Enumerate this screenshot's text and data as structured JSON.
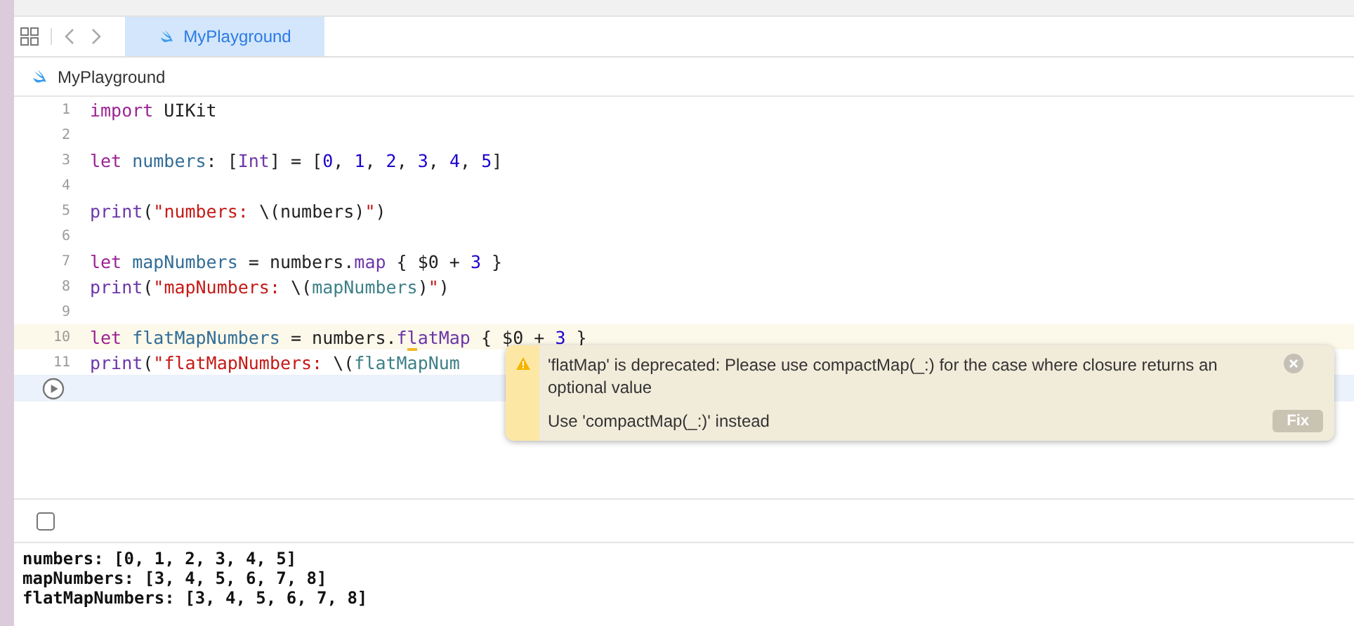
{
  "tabs": [
    {
      "label": "MyPlayground",
      "selected": true
    }
  ],
  "breadcrumb": "MyPlayground",
  "lines": [
    {
      "number": "1",
      "current": false,
      "tokens": [
        {
          "kind": "keyword",
          "text": "import"
        },
        {
          "kind": "plain",
          "text": " UIKit"
        }
      ]
    },
    {
      "number": "2",
      "current": false
    },
    {
      "number": "3",
      "current": false,
      "tokens": [
        {
          "kind": "keyword",
          "text": "let"
        },
        {
          "kind": "decl",
          "text": " numbers"
        },
        {
          "kind": "plain",
          "text": ": ["
        },
        {
          "kind": "type",
          "text": "Int"
        },
        {
          "kind": "plain",
          "text": "] = ["
        },
        {
          "kind": "number",
          "text": "0"
        },
        {
          "kind": "plain",
          "text": ", "
        },
        {
          "kind": "number",
          "text": "1"
        },
        {
          "kind": "plain",
          "text": ", "
        },
        {
          "kind": "number",
          "text": "2"
        },
        {
          "kind": "plain",
          "text": ", "
        },
        {
          "kind": "number",
          "text": "3"
        },
        {
          "kind": "plain",
          "text": ", "
        },
        {
          "kind": "number",
          "text": "4"
        },
        {
          "kind": "plain",
          "text": ", "
        },
        {
          "kind": "number",
          "text": "5"
        },
        {
          "kind": "plain",
          "text": "]"
        }
      ]
    },
    {
      "number": "4",
      "current": false
    },
    {
      "number": "5",
      "current": false,
      "tokens": [
        {
          "kind": "func",
          "text": "print"
        },
        {
          "kind": "plain",
          "text": "("
        },
        {
          "kind": "string",
          "text": "\"numbers: "
        },
        {
          "kind": "plain",
          "text": "\\(numbers)"
        },
        {
          "kind": "string",
          "text": "\""
        },
        {
          "kind": "plain",
          "text": ")"
        }
      ]
    },
    {
      "number": "6",
      "current": false
    },
    {
      "number": "7",
      "current": false,
      "tokens": [
        {
          "kind": "keyword",
          "text": "let"
        },
        {
          "kind": "decl",
          "text": " mapNumbers"
        },
        {
          "kind": "plain",
          "text": " = numbers."
        },
        {
          "kind": "func",
          "text": "map"
        },
        {
          "kind": "plain",
          "text": " { $0 + "
        },
        {
          "kind": "number",
          "text": "3"
        },
        {
          "kind": "plain",
          "text": " }"
        }
      ]
    },
    {
      "number": "8",
      "current": false,
      "tokens": [
        {
          "kind": "func",
          "text": "print"
        },
        {
          "kind": "plain",
          "text": "("
        },
        {
          "kind": "string",
          "text": "\"mapNumbers: "
        },
        {
          "kind": "plain",
          "text": "\\("
        },
        {
          "kind": "ident",
          "text": "mapNumbers"
        },
        {
          "kind": "plain",
          "text": ")"
        },
        {
          "kind": "string",
          "text": "\""
        },
        {
          "kind": "plain",
          "text": ")"
        }
      ]
    },
    {
      "number": "9",
      "current": false
    },
    {
      "number": "10",
      "current": true,
      "tokens": [
        {
          "kind": "keyword",
          "text": "let"
        },
        {
          "kind": "decl",
          "text": " flatMapNumbers"
        },
        {
          "kind": "plain",
          "text": " = numbers."
        },
        {
          "kind": "func",
          "text": "f"
        },
        {
          "kind": "warn",
          "text": "l"
        },
        {
          "kind": "func",
          "text": "atMap"
        },
        {
          "kind": "plain",
          "text": " { $0 + "
        },
        {
          "kind": "number",
          "text": "3"
        },
        {
          "kind": "plain",
          "text": " }"
        }
      ]
    },
    {
      "number": "11",
      "current": false,
      "tokens": [
        {
          "kind": "func",
          "text": "print"
        },
        {
          "kind": "plain",
          "text": "("
        },
        {
          "kind": "string",
          "text": "\"flatMapNumbers: "
        },
        {
          "kind": "plain",
          "text": "\\("
        },
        {
          "kind": "ident",
          "text": "flatMapNum"
        }
      ]
    }
  ],
  "warning": {
    "message": "'flatMap' is deprecated: Please use compactMap(_:) for the case where closure returns an optional value",
    "fix_hint": "Use 'compactMap(_:)' instead",
    "fix_button": "Fix"
  },
  "console": {
    "checked": false,
    "output": [
      "numbers: [0, 1, 2, 3, 4, 5]",
      "mapNumbers: [3, 4, 5, 6, 7, 8]",
      "flatMapNumbers: [3, 4, 5, 6, 7, 8]"
    ]
  }
}
